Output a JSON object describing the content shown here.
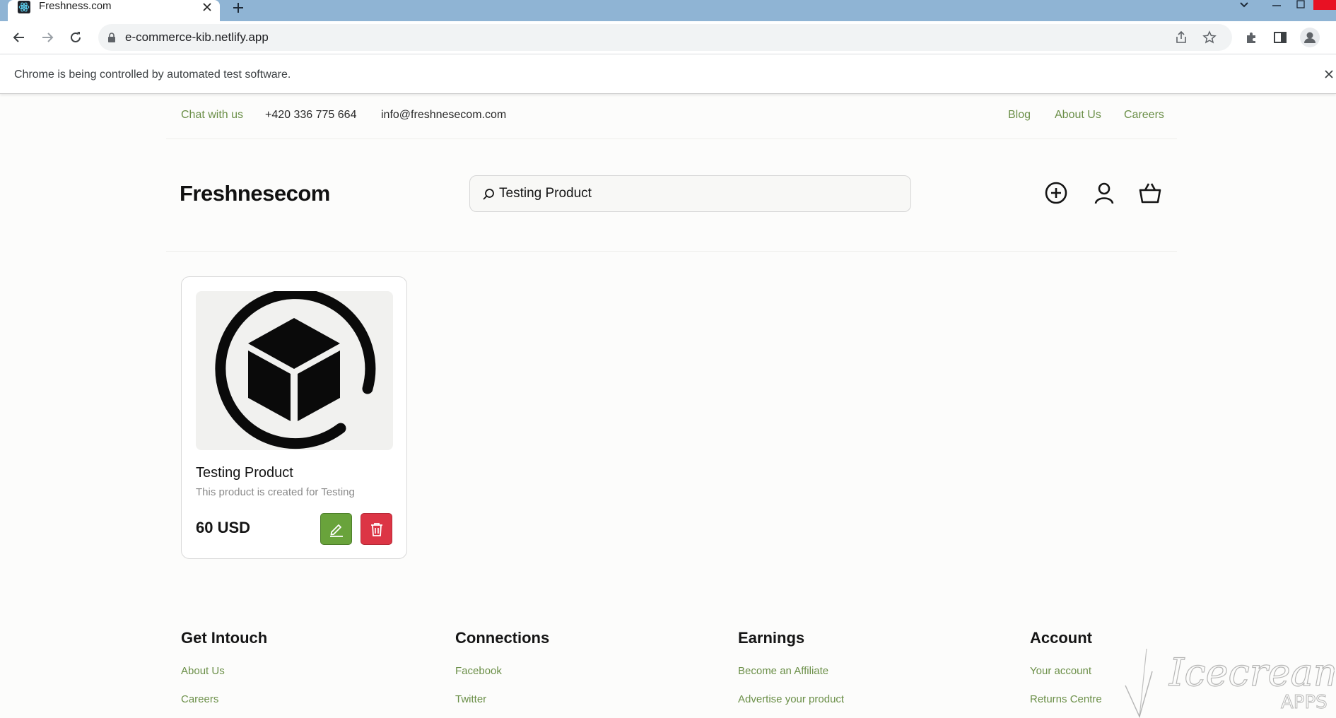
{
  "browser": {
    "tab_title": "Freshness.com",
    "url": "e-commerce-kib.netlify.app",
    "infobar_text": "Chrome is being controlled by automated test software."
  },
  "topbar": {
    "chat": "Chat with us",
    "phone": "+420 336 775 664",
    "email": "info@freshnesecom.com",
    "links": [
      "Blog",
      "About Us",
      "Careers"
    ]
  },
  "header": {
    "logo": "Freshnesecom",
    "search_value": "Testing Product"
  },
  "product": {
    "title": "Testing Product",
    "description": "This product is created for Testing",
    "price": "60 USD"
  },
  "footer": {
    "columns": [
      {
        "heading": "Get Intouch",
        "links": [
          "About Us",
          "Careers"
        ]
      },
      {
        "heading": "Connections",
        "links": [
          "Facebook",
          "Twitter"
        ]
      },
      {
        "heading": "Earnings",
        "links": [
          "Become an Affiliate",
          "Advertise your product"
        ]
      },
      {
        "heading": "Account",
        "links": [
          "Your account",
          "Returns Centre"
        ]
      }
    ]
  },
  "watermark": "Icecream APPS",
  "colors": {
    "accent_green": "#6b8f48",
    "edit_button": "#69a33b",
    "delete_button": "#dc3545"
  }
}
